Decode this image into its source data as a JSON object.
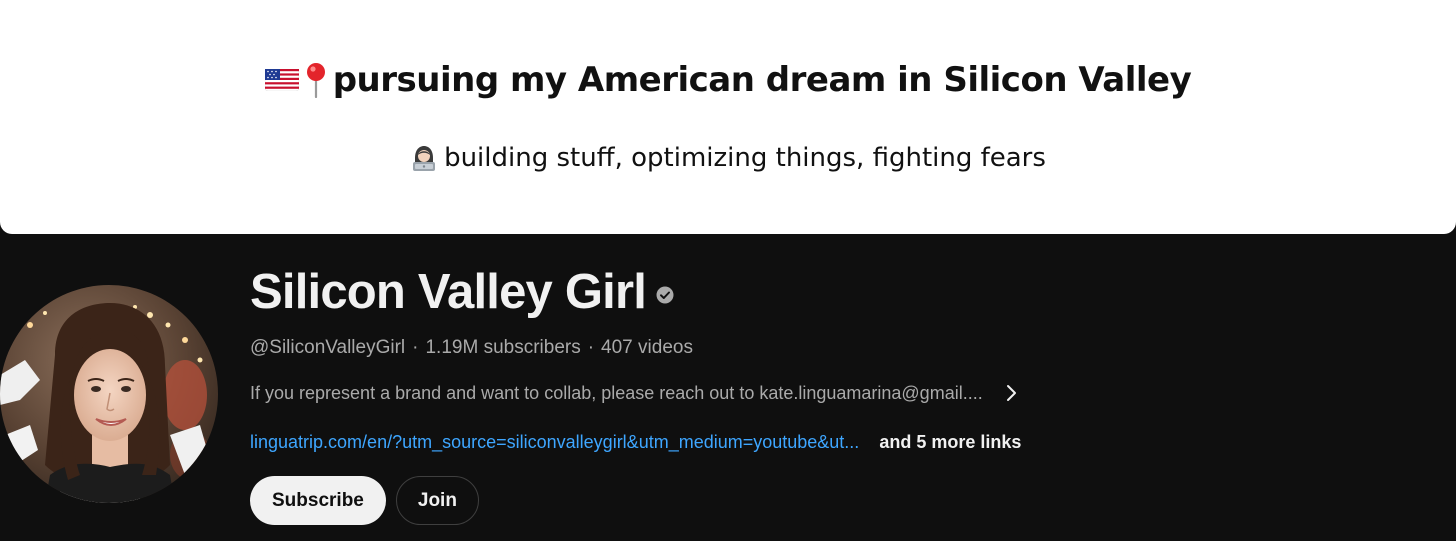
{
  "banner": {
    "headline": "pursuing my American dream in Silicon Valley",
    "headline_icons": [
      "us-flag-icon",
      "round-pushpin-icon"
    ],
    "tagline": "building stuff, optimizing things, fighting fears",
    "tagline_icon": "woman-technologist-icon"
  },
  "channel": {
    "name": "Silicon Valley Girl",
    "verified": true,
    "handle": "@SiliconValleyGirl",
    "subscribers": "1.19M subscribers",
    "videos": "407 videos",
    "meta_separator": "·",
    "description": "If you represent a brand and want to collab, please reach out to kate.linguamarina@gmail....",
    "primary_link": "linguatrip.com/en/?utm_source=siliconvalleygirl&utm_medium=youtube&ut...",
    "more_links": "and 5 more links"
  },
  "actions": {
    "subscribe_label": "Subscribe",
    "join_label": "Join"
  },
  "colors": {
    "background": "#0f0f0f",
    "banner": "#ffffff",
    "text_primary": "#f1f1f1",
    "text_secondary": "#aaaaaa",
    "link": "#3ea6ff"
  }
}
